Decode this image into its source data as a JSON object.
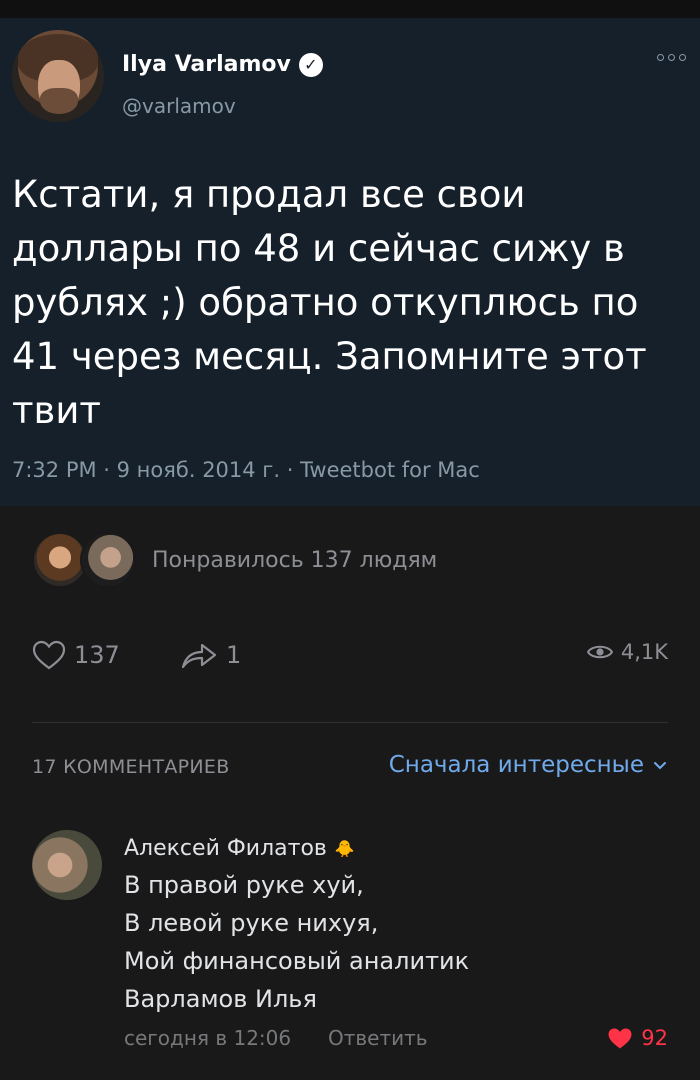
{
  "tweet": {
    "name": "Ilya Varlamov",
    "verified_icon": "verified-check-icon",
    "handle": "@varlamov",
    "lines": [
      "Кстати, я продал все свои",
      "доллары по 48 и сейчас сижу в",
      "рублях ;) обратно откуплюсь по",
      "41 через месяц. Запомните этот",
      "твит"
    ],
    "meta": "7:32 PM · 9 нояб. 2014 г. · Tweetbot for Mac"
  },
  "post": {
    "likes_text": "Понравилось 137 людям",
    "like_count": "137",
    "share_count": "1",
    "views": "4,1K"
  },
  "comments": {
    "count_label": "17 КОММЕНТАРИЕВ",
    "sort_label": "Сначала интересные"
  },
  "comment": {
    "author": "Алексей Филатов",
    "author_badge": "🐥",
    "lines": [
      "В правой руке хуй,",
      "В левой руке нихуя,",
      "Мой финансовый аналитик",
      "Варламов Илья"
    ],
    "time": "сегодня в 12:06",
    "reply": "Ответить",
    "likes": "92"
  },
  "colors": {
    "tweet_bg": "#15202b",
    "page_bg": "#19191a",
    "link": "#71aaeb",
    "like_red": "#ff3347"
  }
}
